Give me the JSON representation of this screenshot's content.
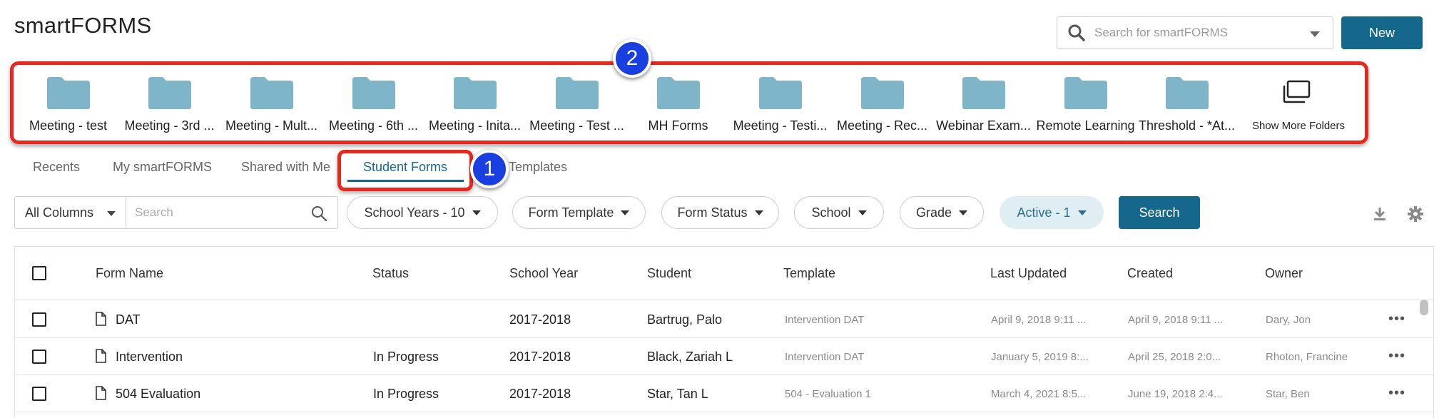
{
  "app": {
    "title": "smartFORMS"
  },
  "header": {
    "search_placeholder": "Search for smartFORMS",
    "new_label": "New"
  },
  "folders": [
    {
      "label": "Meeting - test"
    },
    {
      "label": "Meeting - 3rd ..."
    },
    {
      "label": "Meeting - Mult..."
    },
    {
      "label": "Meeting - 6th ..."
    },
    {
      "label": "Meeting - Inita..."
    },
    {
      "label": "Meeting - Test ..."
    },
    {
      "label": "MH Forms"
    },
    {
      "label": "Meeting - Testi..."
    },
    {
      "label": "Meeting - Rec..."
    },
    {
      "label": "Webinar Exam..."
    },
    {
      "label": "Remote Learning"
    },
    {
      "label": "Threshold - *At..."
    }
  ],
  "show_more": {
    "label": "Show More Folders"
  },
  "callouts": {
    "one": "1",
    "two": "2"
  },
  "tabs": [
    {
      "label": "Recents"
    },
    {
      "label": "My smartFORMS"
    },
    {
      "label": "Shared with Me"
    },
    {
      "label": "Student Forms"
    },
    {
      "label": "Templates"
    }
  ],
  "filters": {
    "column_select": "All Columns",
    "search_placeholder": "Search",
    "pills": [
      {
        "label": "School Years - 10"
      },
      {
        "label": "Form Template"
      },
      {
        "label": "Form Status"
      },
      {
        "label": "School"
      },
      {
        "label": "Grade"
      },
      {
        "label": "Active - 1"
      }
    ],
    "search_button": "Search"
  },
  "table": {
    "columns": [
      "Form Name",
      "Status",
      "School Year",
      "Student",
      "Template",
      "Last Updated",
      "Created",
      "Owner"
    ],
    "rows": [
      {
        "name": "DAT",
        "status": "",
        "year": "2017-2018",
        "student": "Bartrug, Palo",
        "template": "Intervention DAT",
        "updated": "April 9, 2018 9:11 ...",
        "created": "April 9, 2018 9:11 ...",
        "owner": "Dary, Jon"
      },
      {
        "name": "Intervention",
        "status": "In Progress",
        "year": "2017-2018",
        "student": "Black, Zariah L",
        "template": "Intervention DAT",
        "updated": "January 5, 2019 8:...",
        "created": "April 25, 2018 2:0...",
        "owner": "Rhoton, Francine"
      },
      {
        "name": "504 Evaluation",
        "status": "In Progress",
        "year": "2017-2018",
        "student": "Star, Tan L",
        "template": "504 - Evaluation 1",
        "updated": "March 4, 2021 8:5...",
        "created": "June 19, 2018 2:4...",
        "owner": "Star, Ben"
      }
    ]
  },
  "colors": {
    "primary": "#15678c",
    "annotation_red": "#e8281e",
    "callout_blue": "#1a3fe0",
    "folder": "#7fb5c9"
  }
}
